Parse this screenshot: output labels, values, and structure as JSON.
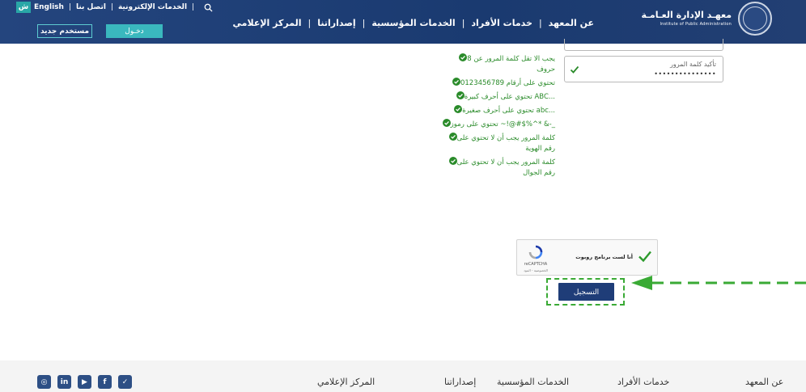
{
  "header": {
    "logo_ar": "معهـد الإدارة العـامـة",
    "logo_en": "Institute of Public Administration",
    "nav": [
      "عن المعهد",
      "خدمات الأفراد",
      "الخدمات المؤسسية",
      "إصداراتنا",
      "المركز الإعلامي"
    ],
    "lang_badge": "ش",
    "lang_label": "English",
    "contact_label": "اتصل بنا",
    "eservices_label": "الخدمات الإلكترونية",
    "new_user_label": "مستخدم جديد",
    "login_label": "دخـول"
  },
  "form": {
    "confirm_label": "تأكيد كلمة المرور",
    "confirm_value": "•••••••••••••••"
  },
  "rules": [
    "يجب الا تقل كلمة المرور عن 8 حروف",
    "تحتوي على أرقام 0123456789",
    "تحتوي على أحرف كبيرة ABC...",
    "تحتوي على أحرف صغيرة abc...",
    "تحتوي على رموز ~!@#$%^* &-_",
    "كلمة المرور يجب أن لا تحتوي على رقم الهوية",
    "كلمة المرور يجب أن لا تحتوي على رقم الجوال"
  ],
  "captcha": {
    "text": "أنا لست برنامج روبوت",
    "brand": "reCAPTCHA",
    "privacy": "الخصوصية - البنود"
  },
  "submit_label": "التسجيل",
  "footer": {
    "nav": [
      "عن المعهد",
      "خدمات الأفراد",
      "الخدمات المؤسسية",
      "إصداراتنا",
      "المركز الإعلامي"
    ],
    "social": [
      "twitter-icon",
      "facebook-icon",
      "youtube-icon",
      "linkedin-icon",
      "instagram-icon"
    ]
  },
  "colors": {
    "header": "#1f3d78",
    "accent": "#3ab8be",
    "success": "#2a8b2a",
    "highlight": "#3aaa35"
  }
}
